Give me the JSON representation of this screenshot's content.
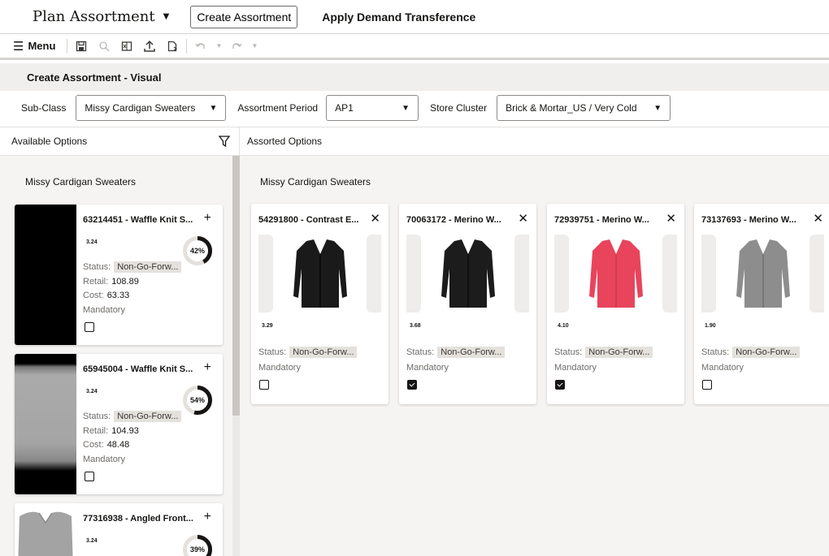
{
  "topbar": {
    "plan_title": "Plan Assortment",
    "create_button": "Create Assortment",
    "apply_link": "Apply Demand Transference"
  },
  "toolbar": {
    "menu_label": "Menu",
    "icons": [
      "save-icon",
      "search-icon",
      "excel-export-icon",
      "upload-icon",
      "document-icon",
      "undo-icon",
      "redo-icon"
    ]
  },
  "section": {
    "title": "Create Assortment - Visual"
  },
  "filters": {
    "subclass_label": "Sub-Class",
    "subclass_value": "Missy Cardigan Sweaters",
    "period_label": "Assortment Period",
    "period_value": "AP1",
    "cluster_label": "Store Cluster",
    "cluster_value": "Brick & Mortar_US / Very Cold"
  },
  "available": {
    "header": "Available Options",
    "group_title": "Missy Cardigan Sweaters",
    "items": [
      {
        "title": "63214451 - Waffle Knit S...",
        "mini": "3.24",
        "percent_label": "42%",
        "percent": 42,
        "status_label": "Status:",
        "status": "Non-Go-Forw...",
        "retail_label": "Retail:",
        "retail": "108.89",
        "cost_label": "Cost:",
        "cost": "63.33",
        "mandatory_label": "Mandatory",
        "checked": false
      },
      {
        "title": "65945004 - Waffle Knit S...",
        "mini": "3.24",
        "percent_label": "54%",
        "percent": 54,
        "status_label": "Status:",
        "status": "Non-Go-Forw...",
        "retail_label": "Retail:",
        "retail": "104.93",
        "cost_label": "Cost:",
        "cost": "48.48",
        "mandatory_label": "Mandatory",
        "checked": false
      },
      {
        "title": "77316938 - Angled Front...",
        "mini": "3.24",
        "percent_label": "39%",
        "percent": 39
      }
    ]
  },
  "assorted": {
    "header": "Assorted Options",
    "group_title": "Missy Cardigan Sweaters",
    "items": [
      {
        "title": "54291800 - Contrast E...",
        "mini": "3.29",
        "status_label": "Status:",
        "status": "Non-Go-Forw...",
        "mandatory_label": "Mandatory",
        "checked": false,
        "color": "#1a1a1a"
      },
      {
        "title": "70063172 - Merino W...",
        "mini": "3.68",
        "status_label": "Status:",
        "status": "Non-Go-Forw...",
        "mandatory_label": "Mandatory",
        "checked": true,
        "color": "#1c1c1c"
      },
      {
        "title": "72939751 - Merino W...",
        "mini": "4.10",
        "status_label": "Status:",
        "status": "Non-Go-Forw...",
        "mandatory_label": "Mandatory",
        "checked": true,
        "color": "#e8445c"
      },
      {
        "title": "73137693 - Merino W...",
        "mini": "1.90",
        "status_label": "Status:",
        "status": "Non-Go-Forw...",
        "mandatory_label": "Mandatory",
        "checked": false,
        "color": "#8d8d8d"
      }
    ]
  }
}
